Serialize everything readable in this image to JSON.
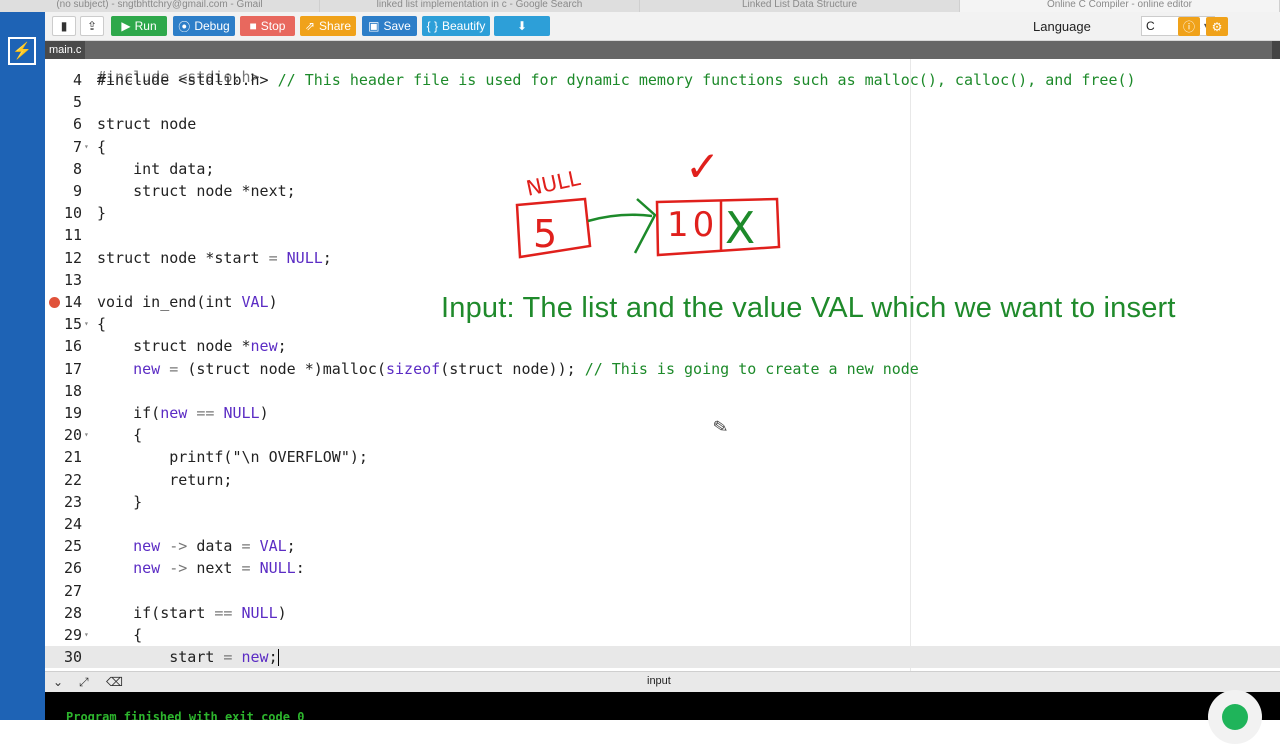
{
  "browser_tabs": [
    {
      "label": "(no subject) - sngtbhttchry@gmail.com - Gmail",
      "active": false
    },
    {
      "label": "linked list implementation in c - Google Search",
      "active": false
    },
    {
      "label": "Linked List Data Structure",
      "active": false
    },
    {
      "label": "Online C Compiler - online editor",
      "active": true
    }
  ],
  "toolbar": {
    "run_label": "Run",
    "debug_label": "Debug",
    "stop_label": "Stop",
    "share_label": "Share",
    "save_label": "Save",
    "beautify_label": "Beautify",
    "language_label": "Language",
    "language_value": "C",
    "colors": {
      "run": "#2ea84b",
      "debug": "#2d7ec8",
      "stop": "#e8685e",
      "share": "#f0a21a",
      "save": "#2d7ec8",
      "beautify": "#2d9fd8",
      "download": "#2d9fd8"
    }
  },
  "file_tab": "main.c",
  "annotation": {
    "text": "Input: The list and the value VAL which we want to insert",
    "color": "#1f8a2b"
  },
  "drawing": {
    "null_label": "NULL",
    "node1_value": "5",
    "node2_value": "10",
    "node2_next": "X",
    "check_mark": "✓",
    "red": "#e0201c",
    "green": "#1d8a2a"
  },
  "code": {
    "partial_top": "#include <stdio.h>",
    "lines": [
      {
        "n": "4",
        "t": "#include <stdlib.h> // This header file is used for dynamic memory functions such as malloc(), calloc(), and free()"
      },
      {
        "n": "5",
        "t": ""
      },
      {
        "n": "6",
        "t": "struct node"
      },
      {
        "n": "7",
        "t": "{"
      },
      {
        "n": "8",
        "t": "    int data;"
      },
      {
        "n": "9",
        "t": "    struct node *next;"
      },
      {
        "n": "10",
        "t": "}"
      },
      {
        "n": "11",
        "t": ""
      },
      {
        "n": "12",
        "t": "struct node *start = NULL;"
      },
      {
        "n": "13",
        "t": ""
      },
      {
        "n": "14",
        "t": "void in_end(int VAL)"
      },
      {
        "n": "15",
        "t": "{"
      },
      {
        "n": "16",
        "t": "    struct node *new;"
      },
      {
        "n": "17",
        "t": "    new = (struct node *)malloc(sizeof(struct node)); // This is going to create a new node"
      },
      {
        "n": "18",
        "t": ""
      },
      {
        "n": "19",
        "t": "    if(new == NULL)"
      },
      {
        "n": "20",
        "t": "    {"
      },
      {
        "n": "21",
        "t": "        printf(\"\\n OVERFLOW\");"
      },
      {
        "n": "22",
        "t": "        return;"
      },
      {
        "n": "23",
        "t": "    }"
      },
      {
        "n": "24",
        "t": ""
      },
      {
        "n": "25",
        "t": "    new -> data = VAL;"
      },
      {
        "n": "26",
        "t": "    new -> next = NULL:"
      },
      {
        "n": "27",
        "t": ""
      },
      {
        "n": "28",
        "t": "    if(start == NULL)"
      },
      {
        "n": "29",
        "t": "    {"
      },
      {
        "n": "30",
        "t": "        start = new;"
      }
    ],
    "breakpoint_line": "14",
    "fold_lines": [
      "7",
      "15",
      "20",
      "29"
    ],
    "current_line": "30"
  },
  "bottom": {
    "input_label": "input",
    "console_text": "Program finished with exit code 0"
  }
}
